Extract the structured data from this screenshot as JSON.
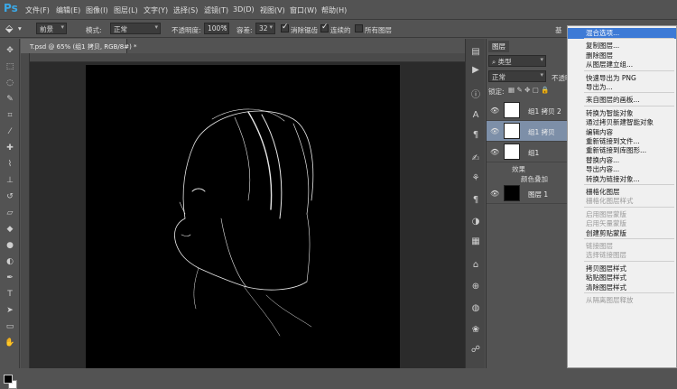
{
  "app": {
    "logo": "Ps"
  },
  "menubar": {
    "items": [
      "文件(F)",
      "编辑(E)",
      "图像(I)",
      "图层(L)",
      "文字(Y)",
      "选择(S)",
      "滤镜(T)",
      "3D(D)",
      "视图(V)",
      "窗口(W)",
      "帮助(H)"
    ]
  },
  "options": {
    "mode_fill": "前景",
    "mode_label": "模式:",
    "mode_value": "正常",
    "opacity_label": "不透明度:",
    "opacity_value": "100%",
    "tolerance_label": "容差:",
    "tolerance_value": "32",
    "antialias_label": "消除锯齿",
    "contiguous_label": "连续的",
    "alllayers_label": "所有图层",
    "right_label": "基"
  },
  "document": {
    "tab_title": "T.psd @ 65% (组1 拷贝, RGB/8#) *"
  },
  "layers_panel": {
    "tab": "图层",
    "kind_filter": "类型",
    "blend_mode": "正常",
    "opacity_label": "不透明",
    "lock_label": "锁定:",
    "layers": [
      {
        "name": "组1 拷贝 2",
        "selected": false,
        "thumb": "white"
      },
      {
        "name": "组1 拷贝",
        "selected": true,
        "thumb": "white"
      },
      {
        "name": "组1",
        "selected": false,
        "thumb": "white"
      },
      {
        "name": "图层 1",
        "selected": false,
        "thumb": "black"
      }
    ],
    "effects_label": "效果",
    "color_overlay_label": "颜色叠加"
  },
  "context_menu": {
    "items": [
      {
        "label": "混合选项...",
        "state": "highlight"
      },
      {
        "sep": true
      },
      {
        "label": "复制图层...",
        "state": "normal"
      },
      {
        "label": "删除图层",
        "state": "normal"
      },
      {
        "label": "从图层建立组...",
        "state": "normal"
      },
      {
        "sep": true
      },
      {
        "label": "快速导出为 PNG",
        "state": "normal"
      },
      {
        "label": "导出为...",
        "state": "normal"
      },
      {
        "sep": true
      },
      {
        "label": "来自图层的画板...",
        "state": "normal"
      },
      {
        "sep": true
      },
      {
        "label": "转换为智能对象",
        "state": "normal"
      },
      {
        "label": "通过拷贝新建智能对象",
        "state": "normal"
      },
      {
        "label": "编辑内容",
        "state": "normal"
      },
      {
        "label": "重新链接到文件...",
        "state": "normal"
      },
      {
        "label": "重新链接到库图形...",
        "state": "normal"
      },
      {
        "label": "替换内容...",
        "state": "normal"
      },
      {
        "label": "导出内容...",
        "state": "normal"
      },
      {
        "label": "转换为链接对象...",
        "state": "normal"
      },
      {
        "sep": true
      },
      {
        "label": "栅格化图层",
        "state": "normal"
      },
      {
        "label": "栅格化图层样式",
        "state": "disabled"
      },
      {
        "sep": true
      },
      {
        "label": "启用图层蒙版",
        "state": "disabled"
      },
      {
        "label": "启用矢量蒙版",
        "state": "disabled"
      },
      {
        "label": "创建剪贴蒙版",
        "state": "normal"
      },
      {
        "sep": true
      },
      {
        "label": "链接图层",
        "state": "disabled"
      },
      {
        "label": "选择链接图层",
        "state": "disabled"
      },
      {
        "sep": true
      },
      {
        "label": "拷贝图层样式",
        "state": "normal"
      },
      {
        "label": "粘贴图层样式",
        "state": "normal"
      },
      {
        "label": "清除图层样式",
        "state": "normal"
      },
      {
        "sep": true
      },
      {
        "label": "从隔离图层释放",
        "state": "disabled"
      }
    ]
  }
}
